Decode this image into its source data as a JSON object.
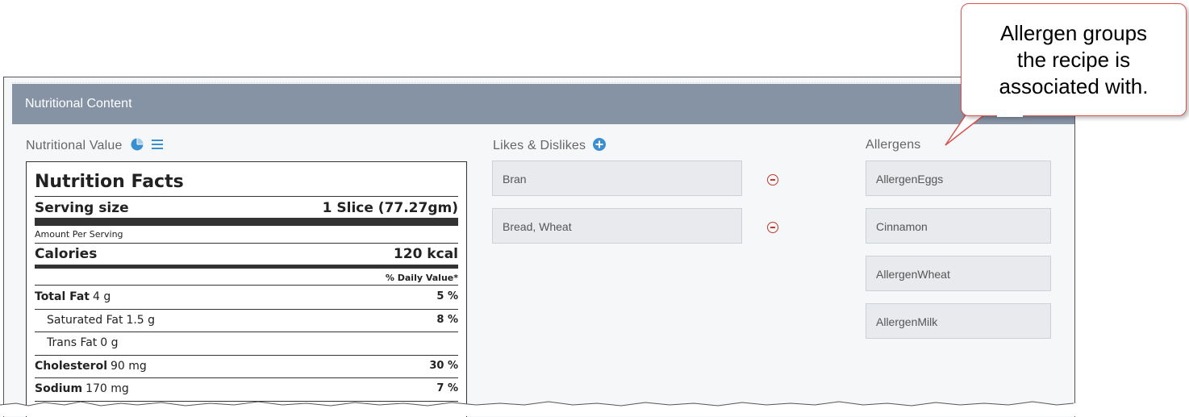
{
  "header": {
    "title": "Nutritional Content"
  },
  "nutritional_value": {
    "title": "Nutritional Value",
    "icons": [
      "pie-chart-icon",
      "list-icon"
    ]
  },
  "nutrition_facts": {
    "title": "Nutrition Facts",
    "serving_label": "Serving size",
    "serving_value": "1 Slice (77.27gm)",
    "amount_per_serving": "Amount Per Serving",
    "calories_label": "Calories",
    "calories_value": "120 kcal",
    "daily_value_header": "% Daily Value*",
    "rows": [
      {
        "label": "Total Fat",
        "amount": "4 g",
        "percent": "5 %",
        "indent": false,
        "bold_label": true
      },
      {
        "label": "Saturated Fat",
        "amount": "1.5 g",
        "percent": "8 %",
        "indent": true,
        "bold_label": false
      },
      {
        "label": "Trans Fat",
        "amount": "0 g",
        "percent": "",
        "indent": true,
        "bold_label": false
      },
      {
        "label": "Cholesterol",
        "amount": "90 mg",
        "percent": "30 %",
        "indent": false,
        "bold_label": true
      },
      {
        "label": "Sodium",
        "amount": "170 mg",
        "percent": "7 %",
        "indent": false,
        "bold_label": true
      }
    ]
  },
  "likes_dislikes": {
    "title": "Likes & Dislikes",
    "items": [
      "Bran",
      "Bread, Wheat"
    ]
  },
  "allergens": {
    "title": "Allergens",
    "items": [
      "AllergenEggs",
      "Cinnamon",
      "AllergenWheat",
      "AllergenMilk"
    ]
  },
  "callout": {
    "line1": "Allergen groups",
    "line2": "the recipe is",
    "line3": "associated with."
  },
  "colors": {
    "header_bg": "#8593a5",
    "accent_blue": "#3a8fd0",
    "remove_red": "#c0392b",
    "callout_border": "#d9534f"
  }
}
